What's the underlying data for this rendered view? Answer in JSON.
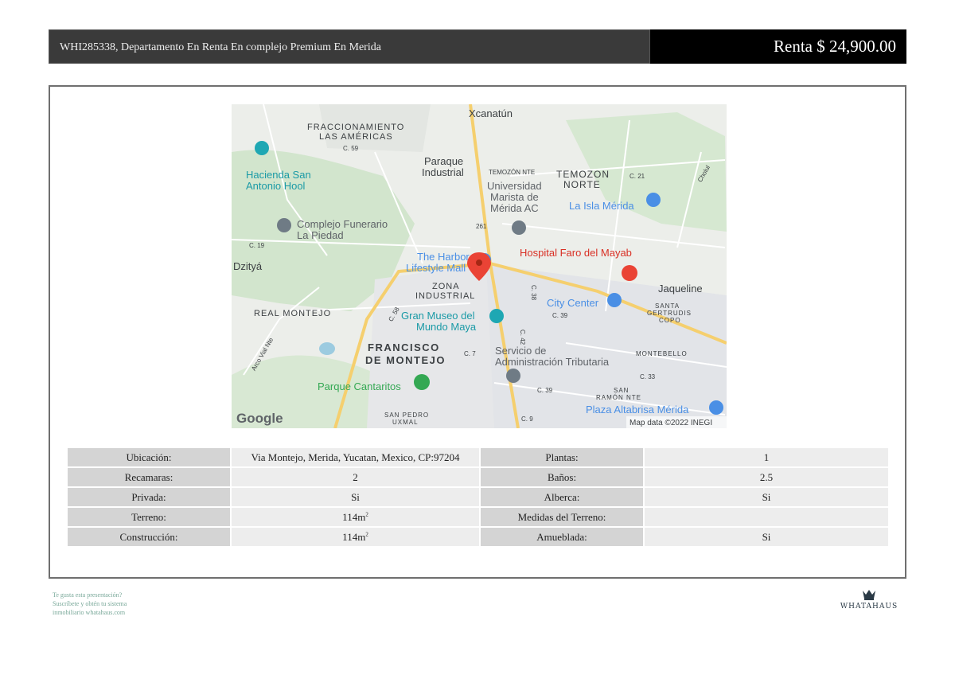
{
  "header": {
    "title": "WHI285338, Departamento En Renta En complejo Premium En Merida",
    "price": "Renta $ 24,900.00"
  },
  "map": {
    "labels": {
      "xcanatun": "Xcanatún",
      "fracc_1": "FRACCIONAMIENTO",
      "fracc_2": "LAS AMÉRICAS",
      "c59": "C. 59",
      "paraque_1": "Paraque",
      "paraque_2": "Industrial",
      "temozon_small": "TEMOZÓN NTE",
      "temozon_1": "TEMOZON",
      "temozon_2": "NORTE",
      "c21": "C. 21",
      "cholul": "Cholul",
      "hacienda_1": "Hacienda San",
      "hacienda_2": "Antonio Hool",
      "univ_1": "Universidad",
      "univ_2": "Marista de",
      "univ_3": "Mérida AC",
      "laisla": "La Isla Mérida",
      "complejo_1": "Complejo Funerario",
      "complejo_2": "La Piedad",
      "hwy": "261",
      "c19": "C. 19",
      "dzitya": "Dzityá",
      "harbor_1": "The Harbor",
      "harbor_2": "Lifestyle Mall",
      "hospital": "Hospital Faro del Mayab",
      "zona_1": "ZONA",
      "zona_2": "INDUSTRIAL",
      "c38": "C. 38",
      "jaqueline": "Jaqueline",
      "real": "REAL MONTEJO",
      "c58": "C. 58",
      "museo_1": "Gran Museo del",
      "museo_2": "Mundo Maya",
      "city": "City Center",
      "c39a": "C. 39",
      "santa_1": "SANTA",
      "santa_2": "GERTRUDIS",
      "santa_3": "COPO",
      "c42": "C. 42",
      "arco": "Arco Vial Nte",
      "franc_1": "FRANCISCO",
      "franc_2": "DE MONTEJO",
      "c7": "C. 7",
      "serv_1": "Servicio de",
      "serv_2": "Administración Tributaria",
      "montebello": "MONTEBELLO",
      "c33": "C. 33",
      "cantaritos": "Parque Cantaritos",
      "c39b": "C. 39",
      "sanramon_1": "SAN",
      "sanramon_2": "RAMÓN NTE",
      "plaza": "Plaza Altabrisa Mérida",
      "google": "Google",
      "sanpedro_1": "SAN PEDRO",
      "sanpedro_2": "UXMAL",
      "c9": "C. 9",
      "mapdata": "Map data ©2022 INEGI"
    },
    "colors": {
      "water": "#9ccbe0",
      "green": "#c8e0c4",
      "road_major": "#f5cf6e",
      "marker": "#ea4335"
    }
  },
  "specs": {
    "rows": [
      {
        "label1": "Ubicación:",
        "value1": "Via Montejo, Merida, Yucatan, Mexico, CP:97204",
        "label2": "Plantas:",
        "value2": "1"
      },
      {
        "label1": "Recamaras:",
        "value1": "2",
        "label2": "Baños:",
        "value2": "2.5"
      },
      {
        "label1": "Privada:",
        "value1": "Si",
        "label2": "Alberca:",
        "value2": "Si"
      },
      {
        "label1": "Terreno:",
        "value1": "114m",
        "value1_sup": "2",
        "label2": "Medidas del Terreno:",
        "value2": ""
      },
      {
        "label1": "Construcción:",
        "value1": "114m",
        "value1_sup": "2",
        "label2": "Amueblada:",
        "value2": "Si"
      }
    ]
  },
  "footer": {
    "line1": "Te gusta esta presentación?",
    "line2": "Suscríbete y obtén tu sistema",
    "line3": "inmobiliario whatahaus.com",
    "logo_text": "WHATAHAUS",
    "logo_icon": "crown-icon"
  }
}
